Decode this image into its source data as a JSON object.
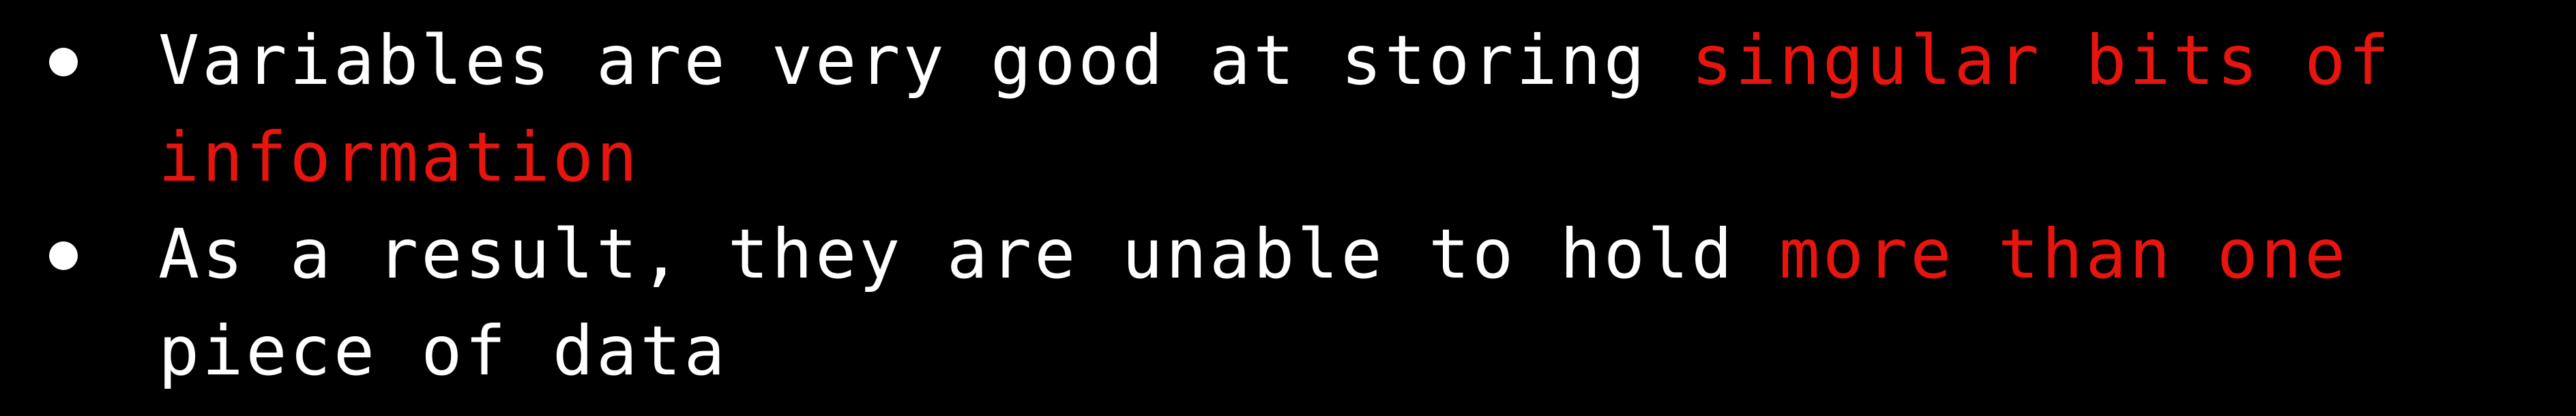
{
  "colors": {
    "background": "#000000",
    "text": "#ffffff",
    "highlight": "#e8150f"
  },
  "bullets": [
    {
      "before": "Variables are very good at storing ",
      "highlight": "singular bits of information",
      "after": ""
    },
    {
      "before": "As a result, they are unable to hold ",
      "highlight": "more than one",
      "after": " piece of data"
    }
  ]
}
